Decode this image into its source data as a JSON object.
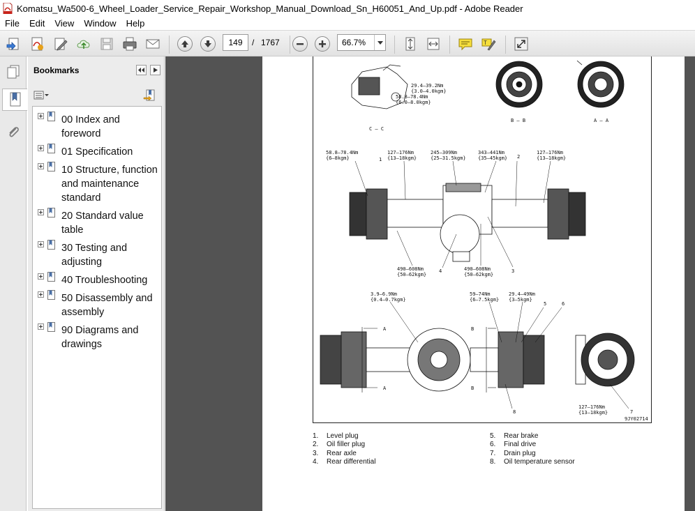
{
  "window": {
    "title": "Komatsu_Wa500-6_Wheel_Loader_Service_Repair_Workshop_Manual_Download_Sn_H60051_And_Up.pdf - Adobe Reader"
  },
  "menu": [
    "File",
    "Edit",
    "View",
    "Window",
    "Help"
  ],
  "toolbar": {
    "current_page": "149",
    "page_separator": "/",
    "total_pages": "1767",
    "zoom": "66.7%"
  },
  "bookmarks": {
    "title": "Bookmarks",
    "items": [
      {
        "label": "00 Index and foreword"
      },
      {
        "label": "01 Specification"
      },
      {
        "label": "10 Structure, function and maintenance standard"
      },
      {
        "label": "20 Standard value table"
      },
      {
        "label": "30 Testing and adjusting"
      },
      {
        "label": "40 Troubleshooting"
      },
      {
        "label": "50 Disassembly and assembly"
      },
      {
        "label": "90 Diagrams and drawings"
      }
    ]
  },
  "document": {
    "figure_id": "9JY02714",
    "view_labels": [
      "C – C",
      "B – B",
      "A – A"
    ],
    "torque_labels": [
      "29.4–39.2Nm",
      "{3.0–4.0kgm}",
      "58.8–78.4Nm",
      "{6.0–8.0kgm}",
      "58.8–78.4Nm",
      "{6–8kgm}",
      "127–176Nm",
      "{13–18kgm}",
      "245–309Nm",
      "{25–31.5kgm}",
      "343–441Nm",
      "{35–45kgm}",
      "127–176Nm",
      "{13–18kgm}",
      "490–608Nm",
      "{50–62kgm}",
      "490–608Nm",
      "{50–62kgm}",
      "3.9–6.9Nm",
      "{0.4–0.7kgm}",
      "59–74Nm",
      "{6–7.5kgm}",
      "29.4–49Nm",
      "{3–5kgm}",
      "127–176Nm",
      "{13–18kgm}"
    ],
    "callouts": [
      "1",
      "2",
      "3",
      "4",
      "5",
      "6",
      "7",
      "8"
    ],
    "section_marks": [
      "A",
      "A",
      "B",
      "B"
    ],
    "legend_left": [
      {
        "num": "1.",
        "text": "Level plug"
      },
      {
        "num": "2.",
        "text": "Oil filler plug"
      },
      {
        "num": "3.",
        "text": "Rear axle"
      },
      {
        "num": "4.",
        "text": "Rear differential"
      }
    ],
    "legend_right": [
      {
        "num": "5.",
        "text": "Rear brake"
      },
      {
        "num": "6.",
        "text": "Final drive"
      },
      {
        "num": "7.",
        "text": "Drain plug"
      },
      {
        "num": "8.",
        "text": "Oil temperature sensor"
      }
    ]
  }
}
